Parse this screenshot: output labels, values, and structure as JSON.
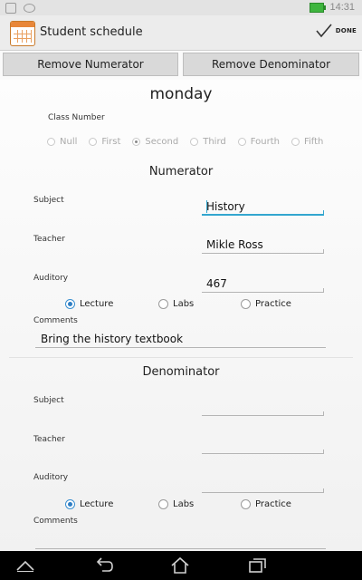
{
  "status_bar": {
    "time": "14:31"
  },
  "action_bar": {
    "title": "Student schedule",
    "done_label": "DONE"
  },
  "toolbar": {
    "remove_numerator": "Remove Numerator",
    "remove_denominator": "Remove Denominator"
  },
  "day": "monday",
  "class_number": {
    "label": "Class Number",
    "options": [
      "Null",
      "First",
      "Second",
      "Third",
      "Fourth",
      "Fifth"
    ],
    "selected": "Second"
  },
  "numerator": {
    "heading": "Numerator",
    "subject_label": "Subject",
    "subject": "History",
    "teacher_label": "Teacher",
    "teacher": "Mikle Ross",
    "auditory_label": "Auditory",
    "auditory": "467",
    "types": [
      "Lecture",
      "Labs",
      "Practice"
    ],
    "selected_type": "Lecture",
    "comments_label": "Comments",
    "comments": "Bring the history textbook"
  },
  "denominator": {
    "heading": "Denominator",
    "subject_label": "Subject",
    "subject": "",
    "teacher_label": "Teacher",
    "teacher": "",
    "auditory_label": "Auditory",
    "auditory": "",
    "types": [
      "Lecture",
      "Labs",
      "Practice"
    ],
    "selected_type": "Lecture",
    "comments_label": "Comments",
    "comments": ""
  },
  "icons": {
    "done": "checkmark-icon",
    "back": "back-icon",
    "home": "home-icon",
    "recents": "recent-apps-icon",
    "collapse": "chevron-up-icon",
    "app": "calendar-icon"
  },
  "colors": {
    "accent": "#33a6cf",
    "radio_selected": "#2e7ec4",
    "navbar": "#000000"
  }
}
